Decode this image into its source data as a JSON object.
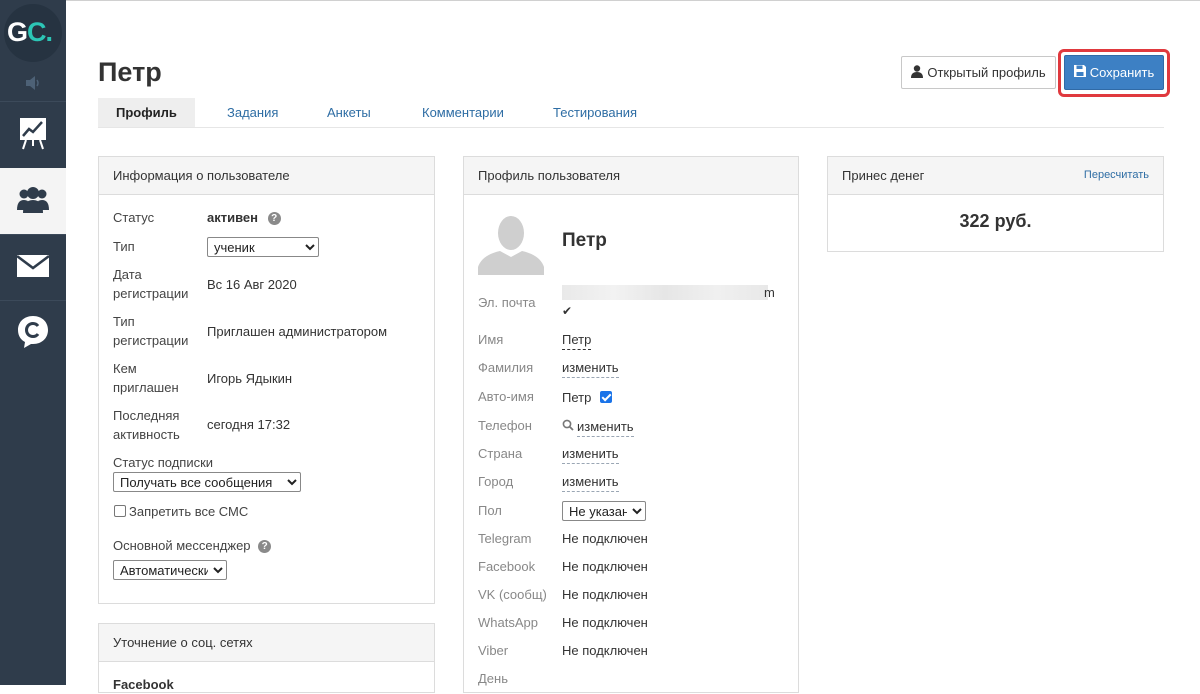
{
  "app": {
    "logo_text": "GC.",
    "nav": [
      "analytics-icon",
      "users-icon",
      "mail-icon",
      "chat-icon"
    ]
  },
  "header": {
    "title": "Петр",
    "open_profile_label": "Открытый профиль",
    "save_label": "Сохранить"
  },
  "tabs": [
    "Профиль",
    "Задания",
    "Анкеты",
    "Комментарии",
    "Тестирования"
  ],
  "user_info": {
    "title": "Информация о пользователе",
    "status_label": "Статус",
    "status_value": "активен",
    "type_label": "Тип",
    "type_value": "ученик",
    "reg_date_label_1": "Дата",
    "reg_date_label_2": "регистрации",
    "reg_date_value": "Вс 16 Авг 2020",
    "reg_type_label_1": "Тип",
    "reg_type_label_2": "регистрации",
    "reg_type_value": "Приглашен администратором",
    "invited_label_1": "Кем",
    "invited_label_2": "приглашен",
    "invited_value": "Игорь Ядыкин",
    "last_active_label_1": "Последняя",
    "last_active_label_2": "активность",
    "last_active_value": "сегодня 17:32",
    "sub_status_label": "Статус подписки",
    "sub_status_value": "Получать все сообщения",
    "no_sms_label": "Запретить все СМС",
    "messenger_label": "Основной мессенджер",
    "messenger_value": "Автоматически"
  },
  "social": {
    "title": "Уточнение о соц. сетях",
    "first_item": "Facebook"
  },
  "profile": {
    "title": "Профиль пользователя",
    "name": "Петр",
    "email_label": "Эл. почта",
    "email_tail": "m",
    "email_check": "✔",
    "first_name_label": "Имя",
    "first_name_value": "Петр",
    "last_name_label": "Фамилия",
    "change": "изменить",
    "auto_name_label": "Авто-имя",
    "auto_name_value": "Петр",
    "phone_label": "Телефон",
    "country_label": "Страна",
    "city_label": "Город",
    "gender_label": "Пол",
    "gender_value": "Не указан",
    "telegram_label": "Telegram",
    "facebook_label": "Facebook",
    "vk_label": "VK (сообщ)",
    "whatsapp_label": "WhatsApp",
    "viber_label": "Viber",
    "not_connected": "Не подключен",
    "birthday_label": "День"
  },
  "money": {
    "title": "Принес денег",
    "recalc": "Пересчитать",
    "amount": "322 руб."
  }
}
